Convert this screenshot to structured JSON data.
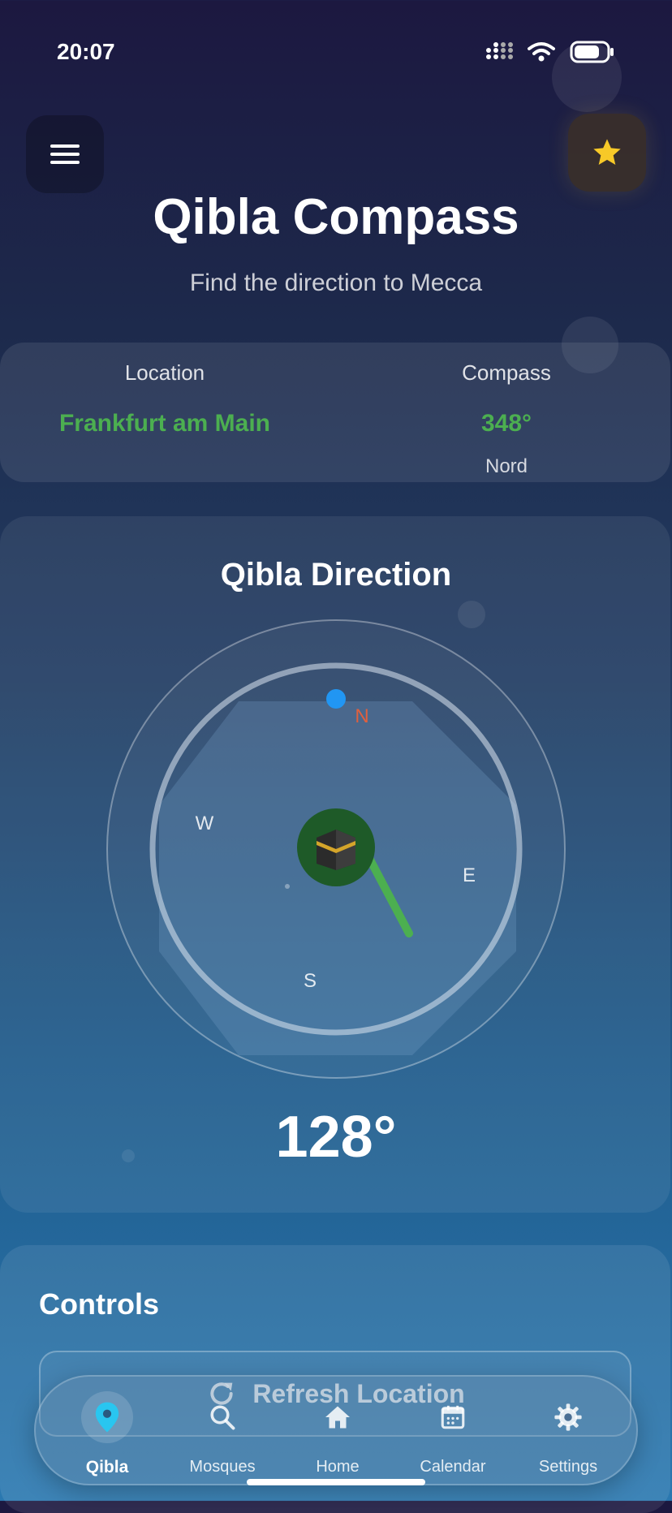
{
  "status_bar": {
    "time": "20:07"
  },
  "header": {
    "menu_icon": "hamburger-menu-icon",
    "favorite_icon": "star-icon",
    "title": "Qibla Compass",
    "subtitle": "Find the direction to Mecca"
  },
  "info": {
    "location_label": "Location",
    "location_value": "Frankfurt am Main",
    "compass_label": "Compass",
    "compass_value": "348°",
    "compass_direction": "Nord"
  },
  "qibla": {
    "title": "Qibla Direction",
    "cardinals": {
      "n": "N",
      "e": "E",
      "s": "S",
      "w": "W"
    },
    "kaaba_icon": "kaaba-icon",
    "degree": "128°",
    "colors": {
      "north": "#e0603e",
      "needle": "#4caf50",
      "kaaba_bg": "#1e5a28",
      "north_dot": "#2196f3"
    }
  },
  "controls": {
    "title": "Controls",
    "refresh_label": "Refresh Location",
    "refresh_icon": "refresh-icon"
  },
  "bottom_nav": {
    "items": [
      {
        "label": "Qibla",
        "icon": "location-pin-icon",
        "active": true
      },
      {
        "label": "Mosques",
        "icon": "search-icon",
        "active": false
      },
      {
        "label": "Home",
        "icon": "home-icon",
        "active": false
      },
      {
        "label": "Calendar",
        "icon": "calendar-icon",
        "active": false
      },
      {
        "label": "Settings",
        "icon": "gear-icon",
        "active": false
      }
    ],
    "accent": "#29c6f0"
  }
}
